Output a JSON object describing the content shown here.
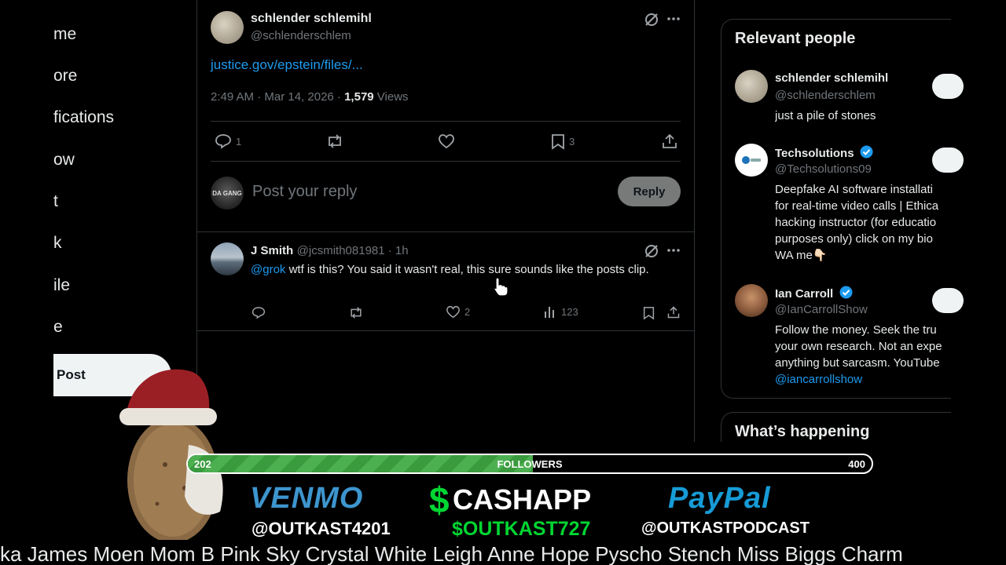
{
  "left_nav": {
    "items": [
      "me",
      "ore",
      "fications",
      "ow",
      "t",
      "k",
      "ile",
      "e"
    ],
    "post_label": "Post"
  },
  "tweet": {
    "author_name": "schlender schlemihl",
    "author_handle": "@schlenderschlem",
    "link_text": "justice.gov/epstein/files/...",
    "timestamp": "2:49 AM · Mar 14, 2026 · ",
    "views_count": "1,579",
    "views_label": " Views",
    "reply_count": "1",
    "bookmark_count": "3"
  },
  "reply_box": {
    "avatar_text": "DA GANG",
    "placeholder": "Post your reply",
    "button_label": "Reply"
  },
  "reply": {
    "name": "J Smith",
    "handle_time": "@jcsmith081981 · 1h",
    "mention": "@grok",
    "text": " wtf is this? You said it wasn't real, this sure sounds like the posts clip.",
    "like_count": "2",
    "view_count": "123"
  },
  "relevant_people": {
    "title": "Relevant people",
    "people": [
      {
        "name": "schlender schlemihl",
        "handle": "@schlenderschlem",
        "bio": "just a pile of stones",
        "verified": false
      },
      {
        "name": "Techsolutions",
        "handle": "@Techsolutions09",
        "bio_lines": [
          "Deepfake AI software installati",
          "for real-time video calls | Ethica",
          "hacking instructor (for educatio",
          "purposes only) click on my bio",
          "WA me👇🏻"
        ],
        "verified": true
      },
      {
        "name": "Ian Carroll",
        "handle": "@IanCarrollShow",
        "bio_lines": [
          "Follow the money. Seek the tru",
          "your own research. Not an expe",
          "anything but sarcasm. YouTube"
        ],
        "bio_link": "@iancarrollshow",
        "verified": true
      }
    ]
  },
  "whats_happening": {
    "title": "What’s happening"
  },
  "stream_overlay": {
    "followers_current": "202",
    "followers_label": "FOLLOWERS",
    "followers_goal": "400",
    "progress_fraction": 0.505,
    "venmo_title": "VENMO",
    "venmo_handle": "@OUTKAST4201",
    "cashapp_symbol": "$",
    "cashapp_title": "CASHAPP",
    "cashapp_handle": "$OUTKAST727",
    "paypal_title": "PayPal",
    "paypal_handle": "@OUTKASTPODCAST",
    "ticker_text": "ka James Moen Mom B  Pink Sky  Crystal White  Leigh Anne Hope Pyscho Stench Miss Biggs Charm"
  },
  "colors": {
    "accent": "#1d9bf0",
    "venmo": "#3d95ce",
    "cashapp": "#00d632",
    "paypal": "#179bd7",
    "progress": "#4caf50"
  }
}
